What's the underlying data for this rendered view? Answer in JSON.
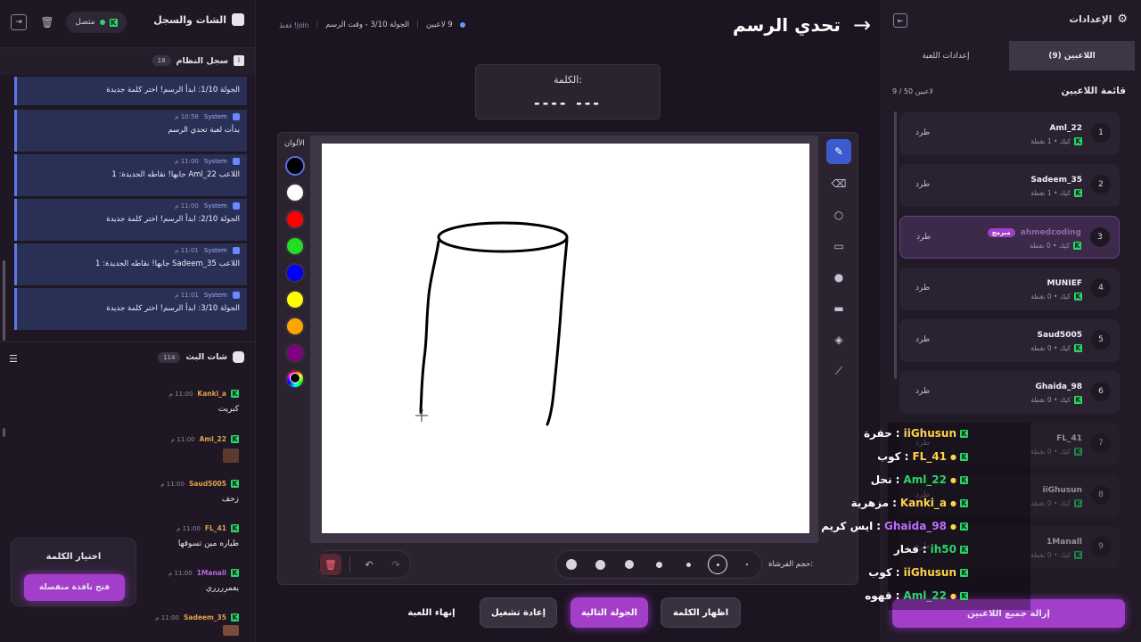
{
  "left": {
    "title": "الشات والسجل",
    "status": "متصل",
    "log_title": "سجل النظام",
    "log_count": "18",
    "log": [
      {
        "author": "",
        "time": "",
        "text": "الجولة 1/10: ابدأ الرسم! اختر كلمة جديدة"
      },
      {
        "author": "System",
        "time": "10:58 م",
        "text": "بدأت لعبة تحدي الرسم"
      },
      {
        "author": "System",
        "time": "11:00 م",
        "text": "اللاعب Aml_22 جابها! نقاطه الجديدة: 1"
      },
      {
        "author": "System",
        "time": "11:00 م",
        "text": "الجولة 2/10: ابدأ الرسم! اختر كلمة جديدة"
      },
      {
        "author": "System",
        "time": "11:01 م",
        "text": "اللاعب Sadeem_35 جابها! نقاطه الجديدة: 1"
      },
      {
        "author": "System",
        "time": "11:01 م",
        "text": "الجولة 3/10: ابدأ الرسم! اختر كلمة جديدة"
      }
    ],
    "chat_title": "شات البث",
    "chat_count": "114",
    "chat": [
      {
        "name": "Kanki_a",
        "time": "11:00 م",
        "text": "كبريت",
        "color": "#e0a04a"
      },
      {
        "name": "Aml_22",
        "time": "11:00 م",
        "text": "",
        "color": "#e0a04a"
      },
      {
        "name": "Saud5005",
        "time": "11:00 م",
        "text": "زحف",
        "color": "#e0a04a"
      },
      {
        "name": "FL_41",
        "time": "11:00 م",
        "text": "طياره مين تسوقها",
        "color": "#e0a04a"
      },
      {
        "name": "1Manall",
        "time": "11:00 م",
        "text": "يعمرررري",
        "color": "#b06be6"
      },
      {
        "name": "Sadeem_35",
        "time": "11:00 م",
        "text": "",
        "color": "#e0a04a"
      }
    ],
    "pick_word": {
      "title": "اختيار الكلمة",
      "button": "فتح نافذة منفصلة"
    }
  },
  "header": {
    "title": "تحدي الرسم",
    "players": "9 لاعبين",
    "round": "الجولة 3/10 - وقت الرسم",
    "join": "join! فقط"
  },
  "word": {
    "label": "الكلمة:",
    "mask": "---- ---"
  },
  "palette": {
    "label": "الألوان",
    "colors": [
      "#000000",
      "#ffffff",
      "#ff0000",
      "#22dd22",
      "#0000ff",
      "#ffff00",
      "#ffa500",
      "#800080"
    ]
  },
  "brush_label": "حجم الفرشاة:",
  "buttons": {
    "show_word": "اظهار الكلمة",
    "next_round": "الجولة التالية",
    "restart": "إعادة تشغيل",
    "end_game": "إنهاء اللعبة"
  },
  "right": {
    "title": "الإعدادات",
    "tab_players": "اللاعبين (9)",
    "tab_settings": "إعدادات اللعبة",
    "list_title": "قائمة اللاعبين",
    "list_count": "9 / 50 لاعبين",
    "kick": "طرد",
    "players": [
      {
        "n": "1",
        "name": "Aml_22",
        "stat": "كيك • 1 نقطة"
      },
      {
        "n": "2",
        "name": "Sadeem_35",
        "stat": "كيك • 1 نقطة"
      },
      {
        "n": "3",
        "name": "ahmedcoding",
        "stat": "كيك • 0 نقطة",
        "badge": "مبرمج"
      },
      {
        "n": "4",
        "name": "MUNIEF",
        "stat": "كيك • 0 نقطة"
      },
      {
        "n": "5",
        "name": "Saud5005",
        "stat": "كيك • 0 نقطة"
      },
      {
        "n": "6",
        "name": "Ghaida_98",
        "stat": "كيك • 0 نقطة"
      },
      {
        "n": "7",
        "name": "FL_41",
        "stat": "كيك • 0 نقطة"
      },
      {
        "n": "8",
        "name": "iiGhusun",
        "stat": "كيك • 0 نقطة"
      },
      {
        "n": "9",
        "name": "1Manall",
        "stat": "كيك • 0 نقطة"
      }
    ],
    "remove_all": "إزالة جميع اللاعبين"
  },
  "overlay": [
    {
      "name": "iiGhusun",
      "word": "حفرة",
      "color": "#ffd24a"
    },
    {
      "name": "FL_41",
      "word": "كوب",
      "color": "#ffd24a"
    },
    {
      "name": "Aml_22",
      "word": "نحل",
      "color": "#2bd46a"
    },
    {
      "name": "Kanki_a",
      "word": "مزهرية",
      "color": "#ffd24a"
    },
    {
      "name": "Ghaida_98",
      "word": "ايس كريم",
      "color": "#c26bff"
    },
    {
      "name": "ih50",
      "word": "فخار",
      "color": "#2bd46a"
    },
    {
      "name": "iiGhusun",
      "word": "كوب",
      "color": "#ffd24a"
    },
    {
      "name": "Aml_22",
      "word": "قهوه",
      "color": "#2bd46a"
    }
  ]
}
